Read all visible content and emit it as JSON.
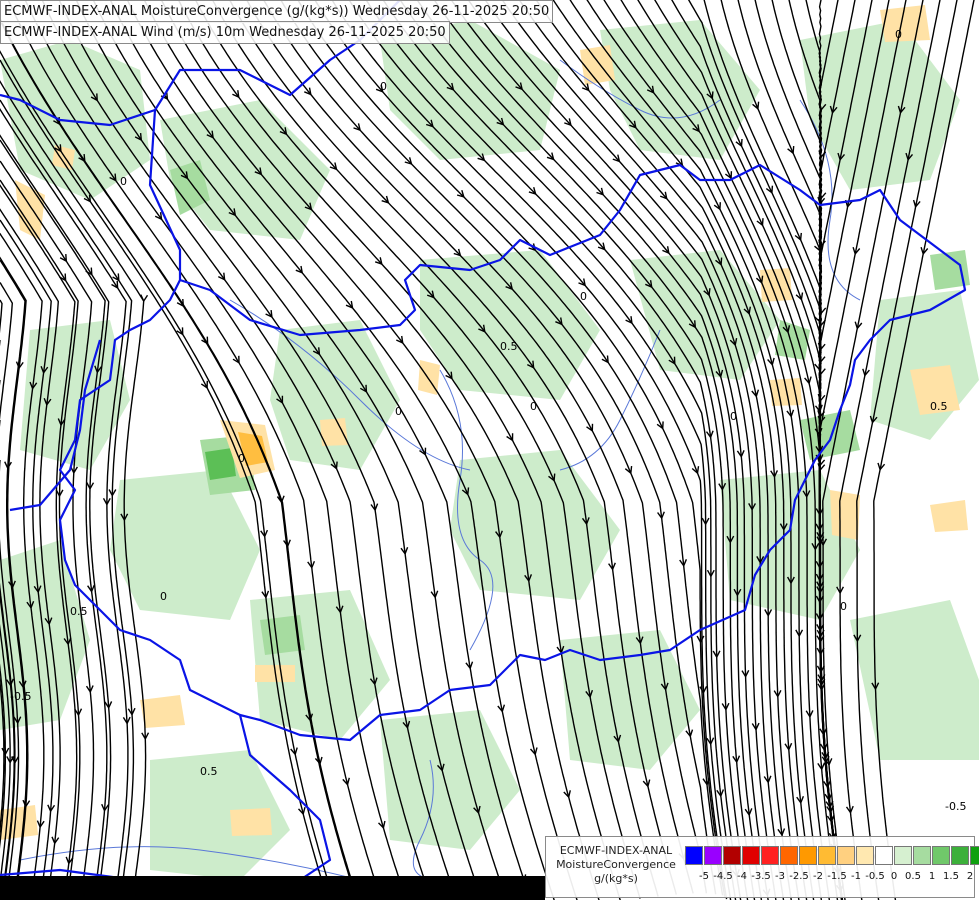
{
  "titles": {
    "line1": "ECMWF-INDEX-ANAL MoistureConvergence (g/(kg*s)) Wednesday 26-11-2025 20:50",
    "line2": "ECMWF-INDEX-ANAL Wind (m/s) 10m Wednesday 26-11-2025 20:50"
  },
  "legend": {
    "title_lines": [
      "ECMWF-INDEX-ANAL",
      "MoistureConvergence",
      "g/(kg*s)"
    ],
    "colors": [
      "#0000ff",
      "#9900ff",
      "#b20000",
      "#e00000",
      "#ff2020",
      "#ff6600",
      "#ff9900",
      "#ffbb33",
      "#ffd080",
      "#ffe8b0",
      "#ffffff",
      "#d6f0d0",
      "#a6dca0",
      "#70c86a",
      "#3cb03a",
      "#10a010"
    ],
    "ticks": [
      "-5",
      "-4.5",
      "-4",
      "-3.5",
      "-3",
      "-2.5",
      "-2",
      "-1.5",
      "-1",
      "-0.5",
      "0",
      "0.5",
      "1",
      "1.5",
      "2"
    ]
  },
  "map_labels": [
    {
      "text": "0"
    },
    {
      "text": "0"
    },
    {
      "text": "0"
    },
    {
      "text": "0.5"
    },
    {
      "text": "0.5"
    },
    {
      "text": "0"
    },
    {
      "text": "-0.5"
    },
    {
      "text": "0"
    },
    {
      "text": "0.5"
    },
    {
      "text": "0"
    },
    {
      "text": "0"
    },
    {
      "text": "0"
    },
    {
      "text": "-0.5"
    },
    {
      "text": "0"
    },
    {
      "text": "0"
    },
    {
      "text": "0.5"
    }
  ],
  "colors": {
    "green_light": "#cdeccb",
    "green_mid": "#a6dca0",
    "green_dark": "#5cbf56",
    "orange_light": "#ffe2a6",
    "orange": "#ffbe40",
    "border": "#0a14e6",
    "river": "#5a78d8",
    "streamline": "#000000"
  }
}
